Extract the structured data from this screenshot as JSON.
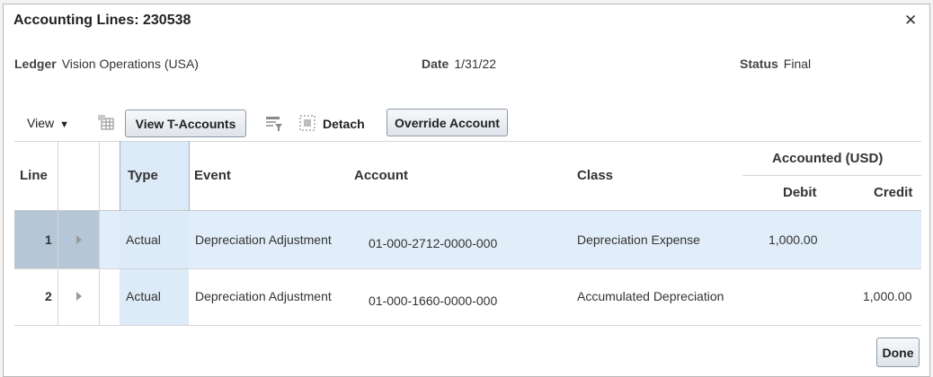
{
  "dialog": {
    "title": "Accounting Lines: 230538",
    "close_icon": "close-icon"
  },
  "header": {
    "ledger_label": "Ledger",
    "ledger_value": "Vision Operations (USA)",
    "date_label": "Date",
    "date_value": "1/31/22",
    "status_label": "Status",
    "status_value": "Final"
  },
  "toolbar": {
    "view_label": "View",
    "view_arrow_icon": "caret-down-icon",
    "freeze_icon": "freeze-columns-icon",
    "view_t_accounts_label": "View T-Accounts",
    "filter_icon": "query-by-example-icon",
    "detach_icon": "detach-icon",
    "detach_label": "Detach",
    "override_account_label": "Override Account"
  },
  "table": {
    "columns": {
      "line": "Line",
      "type": "Type",
      "event": "Event",
      "account": "Account",
      "class": "Class",
      "accounted_group": "Accounted (USD)",
      "debit": "Debit",
      "credit": "Credit"
    },
    "rows": [
      {
        "line": "1",
        "type": "Actual",
        "event": "Depreciation Adjustment",
        "account": "01-000-2712-0000-000",
        "class": "Depreciation Expense",
        "debit": "1,000.00",
        "credit": "",
        "selected": true
      },
      {
        "line": "2",
        "type": "Actual",
        "event": "Depreciation Adjustment",
        "account": "01-000-1660-0000-000",
        "class": "Accumulated Depreciation",
        "debit": "",
        "credit": "1,000.00",
        "selected": false
      }
    ]
  },
  "footer": {
    "done_label": "Done"
  },
  "colors": {
    "selected_row": "#e1eef9",
    "selected_line_cell": "#b5c7d6",
    "type_column_highlight": "#ddeaf7"
  }
}
